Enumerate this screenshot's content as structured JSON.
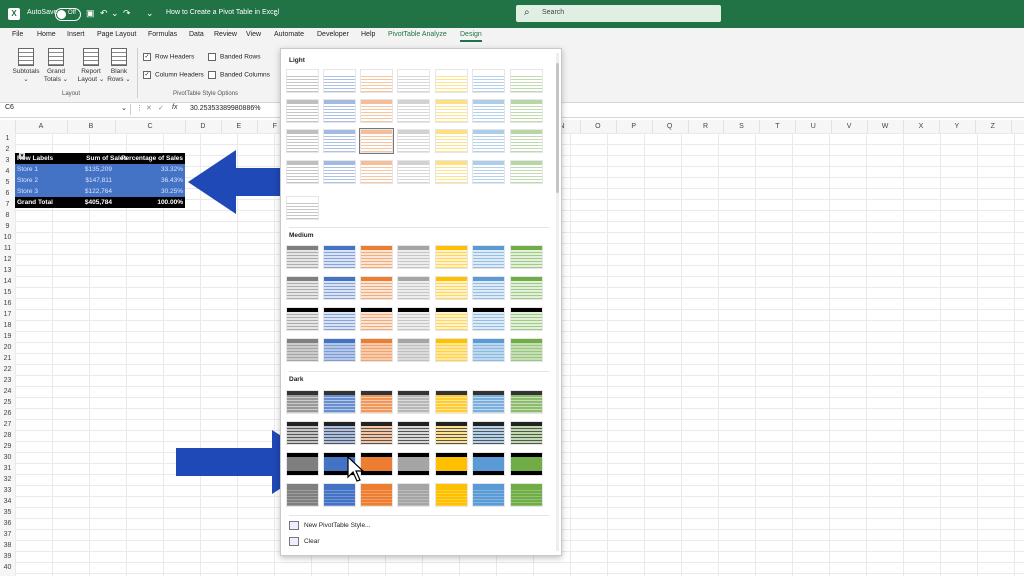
{
  "window": {
    "autosave_label": "AutoSave",
    "autosave_state": "Off",
    "title": "How to Create a Pivot Table in Excel",
    "search_placeholder": "Search"
  },
  "menu_tabs": [
    "File",
    "Home",
    "Insert",
    "Page Layout",
    "Formulas",
    "Data",
    "Review",
    "View",
    "Automate",
    "Developer",
    "Help",
    "PivotTable Analyze",
    "Design"
  ],
  "ribbon": {
    "subtotals": "Subtotals",
    "grand_totals": "Grand Totals",
    "report_layout": "Report Layout",
    "blank_rows": "Blank Rows",
    "layout_group": "Layout",
    "row_headers": "Row Headers",
    "column_headers": "Column Headers",
    "banded_rows": "Banded Rows",
    "banded_columns": "Banded Columns",
    "style_options_group": "PivotTable Style Options"
  },
  "formula_bar": {
    "cell_ref": "C6",
    "fx": "fx",
    "value": "30.25353389980886%"
  },
  "columns": [
    "A",
    "B",
    "C",
    "D",
    "E",
    "F",
    "G",
    "H",
    "I",
    "J",
    "K",
    "L",
    "M",
    "N",
    "O",
    "P",
    "Q",
    "R",
    "S",
    "T",
    "U",
    "V",
    "W",
    "X",
    "Y",
    "Z"
  ],
  "rows": [
    "1",
    "2",
    "3",
    "4",
    "5",
    "6",
    "7",
    "8",
    "9",
    "10",
    "11",
    "12",
    "13",
    "14",
    "15",
    "16",
    "17",
    "18",
    "19",
    "20",
    "21",
    "22",
    "23",
    "24",
    "25",
    "26",
    "27",
    "28",
    "29",
    "30",
    "31",
    "32",
    "33",
    "34",
    "35",
    "36",
    "37",
    "38",
    "39",
    "40"
  ],
  "pivot": {
    "headers": [
      "Row Labels",
      "Sum of Sales",
      "Percentage of Sales"
    ],
    "rows": [
      [
        "Store 1",
        "$135,209",
        "33.32%"
      ],
      [
        "Store 2",
        "$147,811",
        "36.43%"
      ],
      [
        "Store 3",
        "$122,764",
        "30.25%"
      ]
    ],
    "total": [
      "Grand Total",
      "$405,784",
      "100.00%"
    ]
  },
  "gallery": {
    "light_label": "Light",
    "medium_label": "Medium",
    "dark_label": "Dark",
    "new_style": "New PivotTable Style...",
    "clear": "Clear",
    "palette": [
      "#7f7f7f",
      "#4472c4",
      "#ed7d31",
      "#a5a5a5",
      "#ffc000",
      "#5b9bd5",
      "#70ad47"
    ]
  },
  "colors": {
    "excel_green": "#217346",
    "pivot_blue": "#4472c4",
    "arrow_blue": "#1f49b6"
  }
}
